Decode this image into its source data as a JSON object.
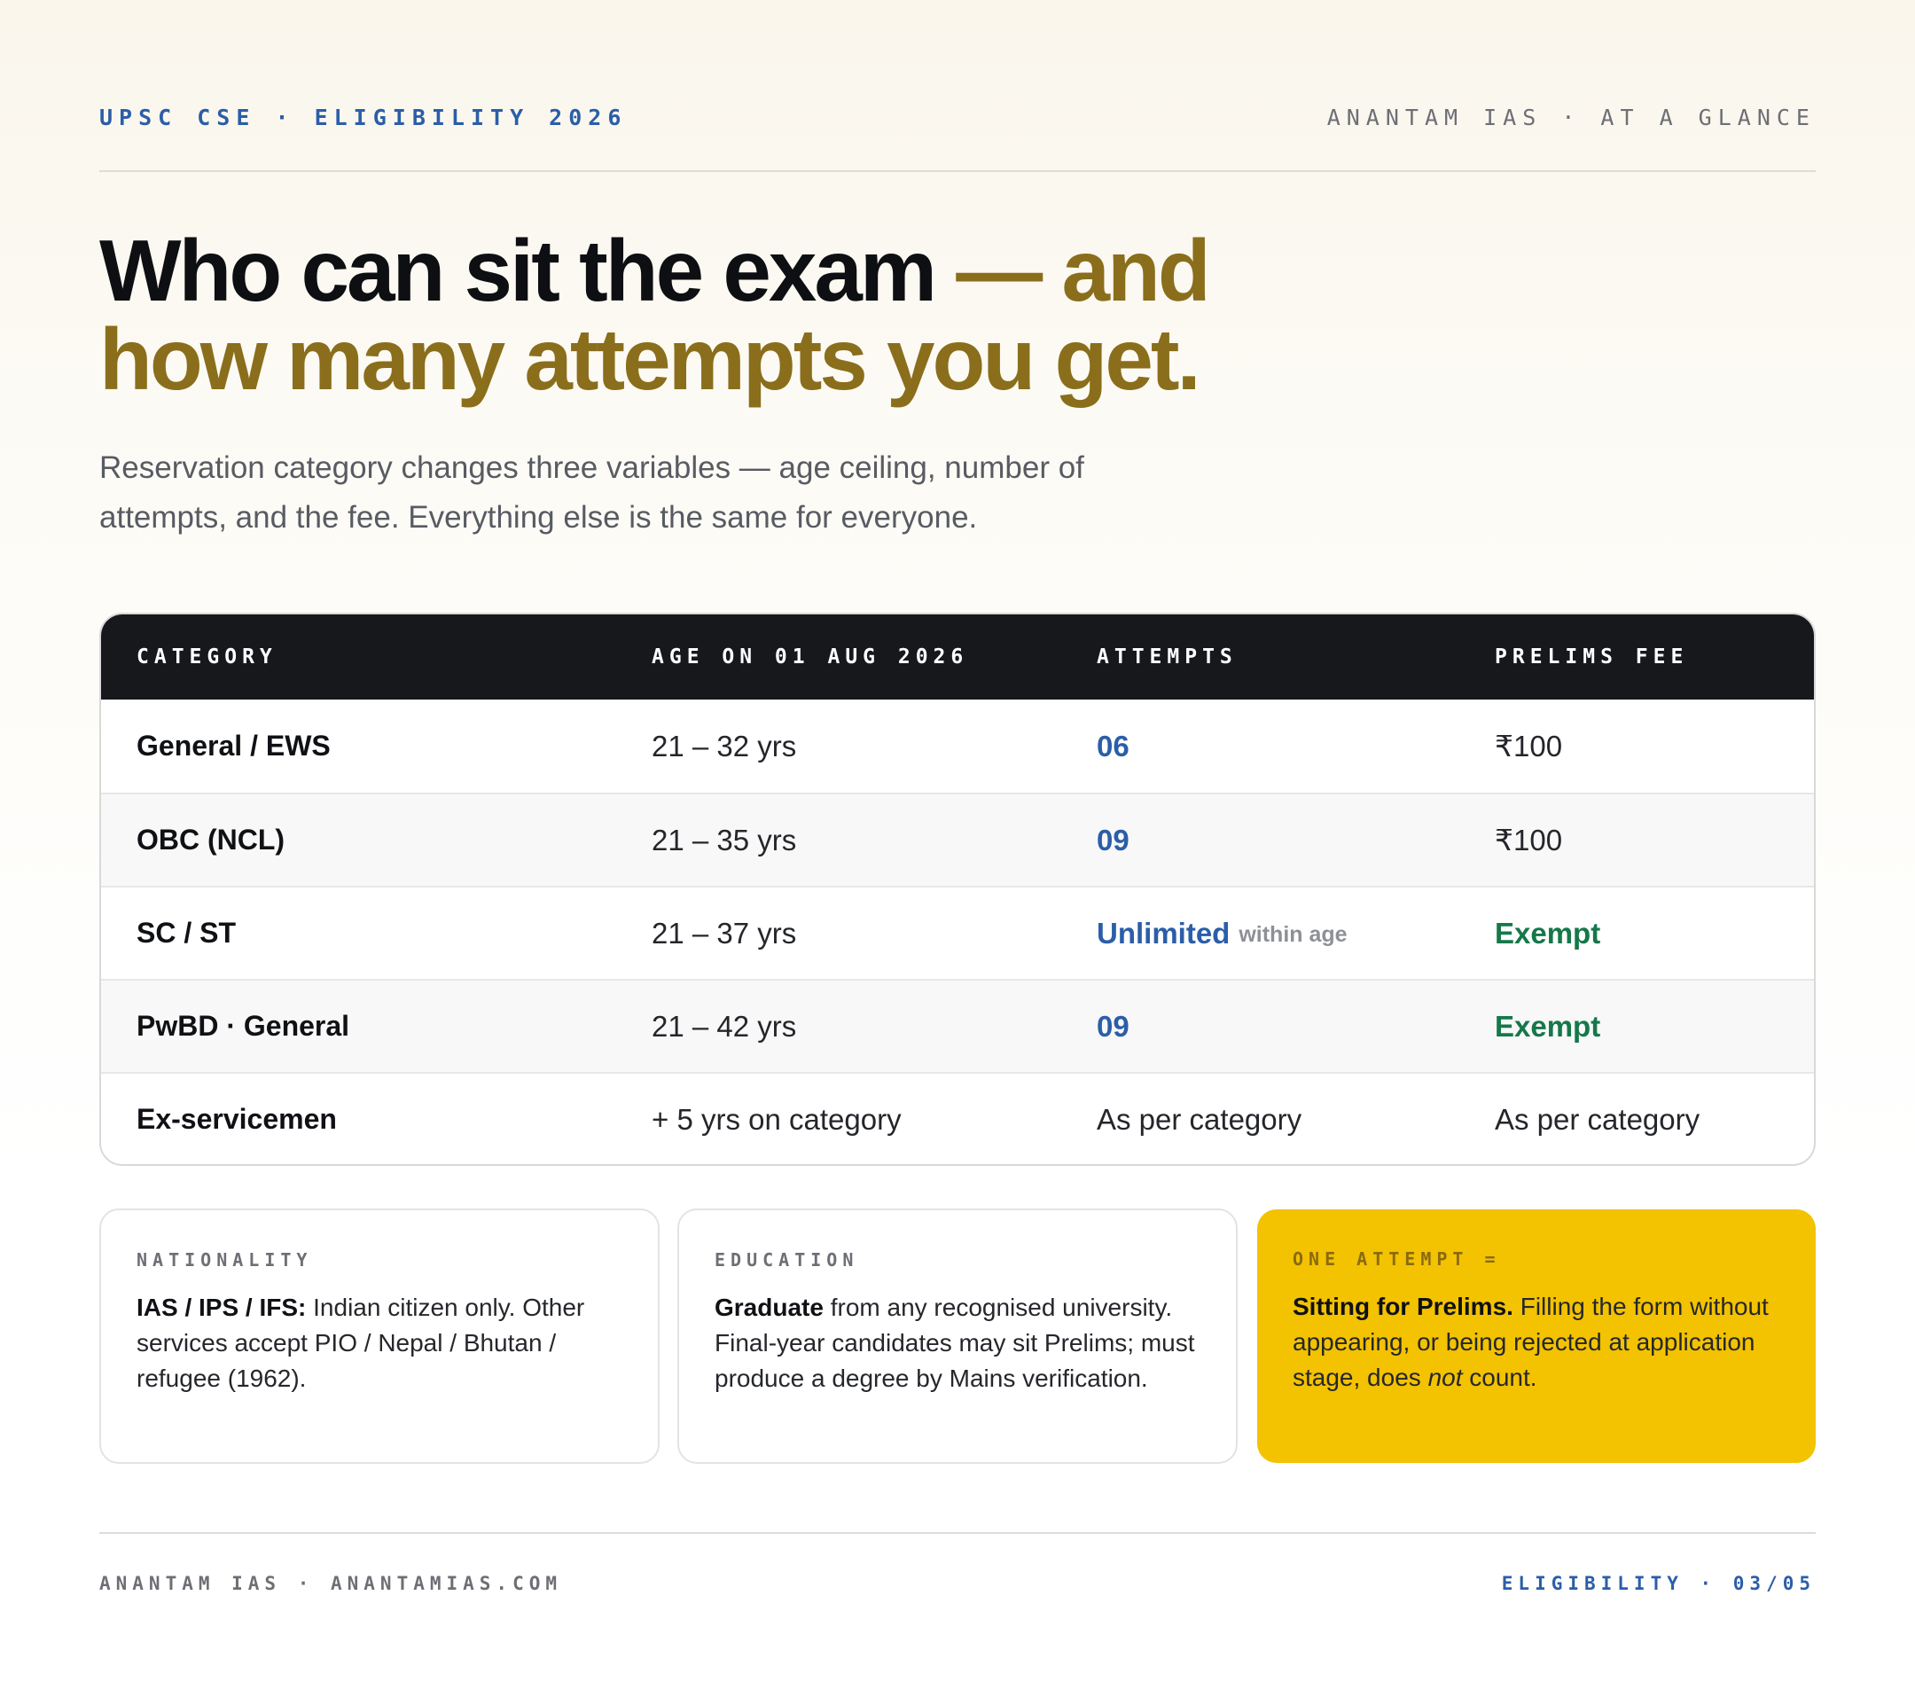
{
  "header": {
    "kicker": "UPSC CSE · ELIGIBILITY 2026",
    "brand": "ANANTAM IAS · AT A GLANCE"
  },
  "headline": {
    "part1": "Who can sit the exam ",
    "part2": "— and how many attempts you get."
  },
  "subhead": "Reservation category changes three variables — age ceiling, number of attempts, and the fee. Everything else is the same for everyone.",
  "table": {
    "headers": [
      "CATEGORY",
      "AGE ON 01 AUG 2026",
      "ATTEMPTS",
      "PRELIMS FEE"
    ],
    "rows": [
      {
        "category": "General / EWS",
        "age": "21 – 32 yrs",
        "attempts": "06",
        "attempts_note": "",
        "fee": "₹100"
      },
      {
        "category": "OBC (NCL)",
        "age": "21 – 35 yrs",
        "attempts": "09",
        "attempts_note": "",
        "fee": "₹100"
      },
      {
        "category": "SC / ST",
        "age": "21 – 37 yrs",
        "attempts": "Unlimited",
        "attempts_note": "within age",
        "fee": "Exempt"
      },
      {
        "category": "PwBD · General",
        "age": "21 – 42 yrs",
        "attempts": "09",
        "attempts_note": "",
        "fee": "Exempt"
      },
      {
        "category": "Ex-servicemen",
        "age": "+ 5 yrs on category",
        "attempts": "As per category",
        "attempts_note": "",
        "fee": "As per category"
      }
    ]
  },
  "cards": {
    "nationality": {
      "label": "NATIONALITY",
      "lead": "IAS / IPS / IFS:",
      "text": " Indian citizen only. Other services accept PIO / Nepal / Bhutan / refugee (1962)."
    },
    "education": {
      "label": "EDUCATION",
      "lead": "Graduate",
      "text": " from any recognised university. Final-year candidates may sit Prelims; must produce a degree by Mains verification."
    },
    "attempt": {
      "label": "ONE ATTEMPT =",
      "lead": "Sitting for Prelims.",
      "text_before": " Filling the form without appearing, or being rejected at application stage, does ",
      "emphasis": "not",
      "text_after": " count."
    }
  },
  "footer": {
    "left": "ANANTAM IAS · ANANTAMIAS.COM",
    "right": "ELIGIBILITY · 03/05"
  },
  "colors": {
    "accent_blue": "#2b5ea8",
    "gold": "#8a6e1c",
    "exempt_green": "#15784a",
    "highlight_yellow": "#f3c200",
    "table_header": "#17181c"
  }
}
